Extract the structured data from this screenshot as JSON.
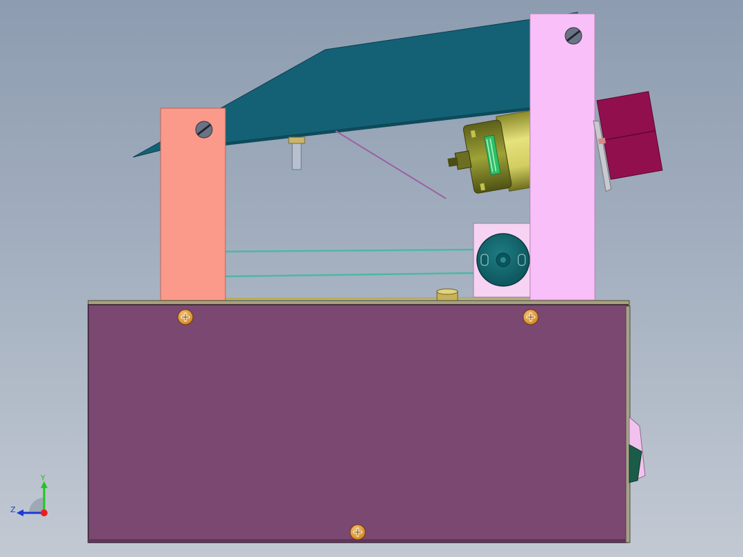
{
  "viewport": {
    "type": "cad-3d-viewport",
    "background": [
      "#8d9cb0",
      "#c2c9d3"
    ]
  },
  "model": {
    "parts": [
      "base-box",
      "left-bracket",
      "right-bracket",
      "top-plate",
      "motor",
      "pulley",
      "fan",
      "side-switch",
      "guide-rods",
      "screws"
    ],
    "colors": {
      "base_box": "#7b4872",
      "left_bracket": "#fb9a8a",
      "right_bracket": "#f8bff8",
      "top_plate": "#146176",
      "motor_body": "#d8d46a",
      "fan": "#920f4e",
      "pulley": "#0f6268",
      "screw": "#e39a3c"
    }
  },
  "triad": {
    "y_label": "Y",
    "z_label": "Z",
    "y_color": "#22c422",
    "z_color": "#1c3ad6",
    "x_color": "#e81e1e"
  }
}
